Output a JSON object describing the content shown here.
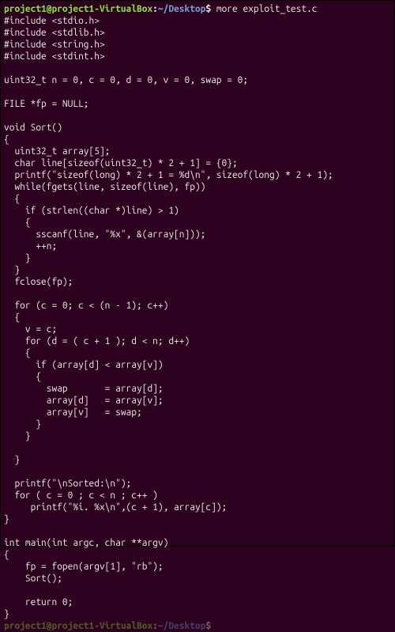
{
  "prompt1": {
    "user": "project1@project1-VirtualBox",
    "sep": ":",
    "path": "~/Desktop",
    "dollar": "$ ",
    "cmd": "more exploit_test.c"
  },
  "code": [
    "#include <stdio.h>",
    "#include <stdlib.h>",
    "#include <string.h>",
    "#include <stdint.h>",
    "",
    "uint32_t n = 0, c = 0, d = 0, v = 0, swap = 0;",
    "",
    "FILE *fp = NULL;",
    "",
    "void Sort()",
    "{",
    "  uint32_t array[5];",
    "  char line[sizeof(uint32_t) * 2 + 1] = {0};",
    "  printf(\"sizeof(long) * 2 + 1 = %d\\n\", sizeof(long) * 2 + 1);",
    "  while(fgets(line, sizeof(line), fp))",
    "  {",
    "    if (strlen((char *)line) > 1)",
    "    {",
    "      sscanf(line, \"%x\", &(array[n]));",
    "      ++n;",
    "    }",
    "  }",
    "  fclose(fp);",
    "",
    "  for (c = 0; c < (n - 1); c++)",
    "  {",
    "    v = c;",
    "    for (d = ( c + 1 ); d < n; d++)",
    "    {",
    "      if (array[d] < array[v])",
    "      {",
    "        swap       = array[d];",
    "        array[d]   = array[v];",
    "        array[v]   = swap;",
    "      }",
    "    }",
    "",
    "  }",
    "",
    "  printf(\"\\nSorted:\\n\");",
    "  for ( c = 0 ; c < n ; c++ )",
    "     printf(\"%i. %x\\n\",(c + 1), array[c]);",
    "}",
    "",
    "int main(int argc, char **argv)",
    "{",
    "    fp = fopen(argv[1], \"rb\");",
    "    Sort();",
    "",
    "    return 0;",
    "}"
  ],
  "prompt2": {
    "user": "project1@project1-VirtualBox",
    "sep": ":",
    "path": "~/Desktop",
    "dollar": "$ "
  }
}
